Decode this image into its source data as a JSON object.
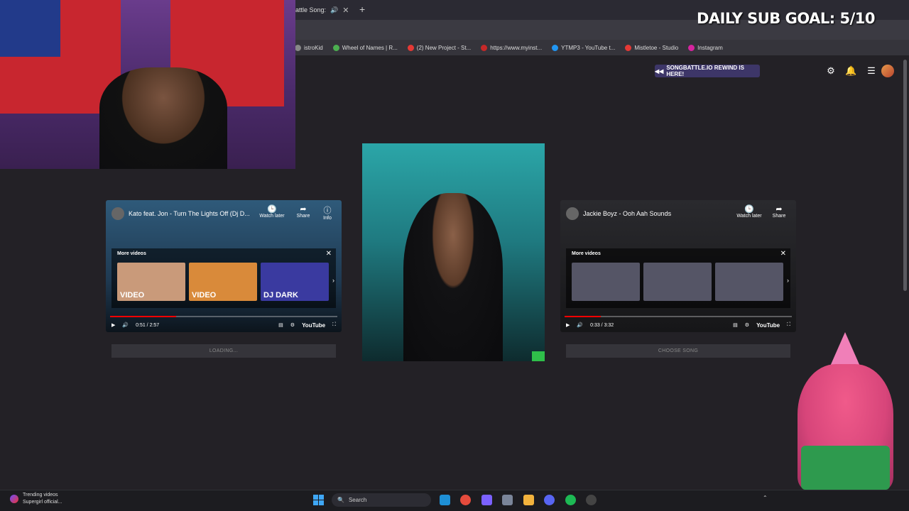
{
  "browser": {
    "tab_title": "Battle Song:",
    "bookmarks": [
      {
        "label": "istroKid",
        "color": "#888888"
      },
      {
        "label": "Wheel of Names | R...",
        "color": "#4caf50"
      },
      {
        "label": "(2) New Project - St...",
        "color": "#e53935"
      },
      {
        "label": "https://www.myinst...",
        "color": "#c62828"
      },
      {
        "label": "YTMP3 - YouTube t...",
        "color": "#2196f3"
      },
      {
        "label": "Mistletoe - Studio",
        "color": "#e53935"
      },
      {
        "label": "Instagram",
        "color": "#d6249f"
      }
    ]
  },
  "overlay": {
    "goal_text": "DAILY SUB GOAL: 5/10"
  },
  "header": {
    "rewind_label": "SONGBATTLE.IO REWIND IS HERE!"
  },
  "left_player": {
    "title": "Kato feat. Jon - Turn The Lights Off (Dj D...",
    "watch_later": "Watch later",
    "share": "Share",
    "info": "Info",
    "more_videos": "More videos",
    "thumbs": [
      {
        "label": "VIDEO",
        "color": "#c99a7a"
      },
      {
        "label": "VIDEO",
        "color": "#d98a3a"
      },
      {
        "label": "DJ DARK",
        "color": "#3a3aa0"
      }
    ],
    "time": "0:51 / 2:57",
    "progress": 0.29,
    "youtube": "YouTube",
    "status_label": "LOADING..."
  },
  "right_player": {
    "title": "Jackie Boyz - Ooh Aah Sounds",
    "watch_later": "Watch later",
    "share": "Share",
    "more_videos": "More videos",
    "thumbs": [
      {
        "label": "",
        "color": "#556"
      },
      {
        "label": "",
        "color": "#556"
      },
      {
        "label": "",
        "color": "#556"
      }
    ],
    "time": "0:33 / 3:32",
    "progress": 0.16,
    "youtube": "YouTube",
    "status_label": "CHOOSE SONG"
  },
  "taskbar": {
    "news_line1": "Trending videos",
    "news_line2": "Supergirl official...",
    "search_placeholder": "Search"
  }
}
